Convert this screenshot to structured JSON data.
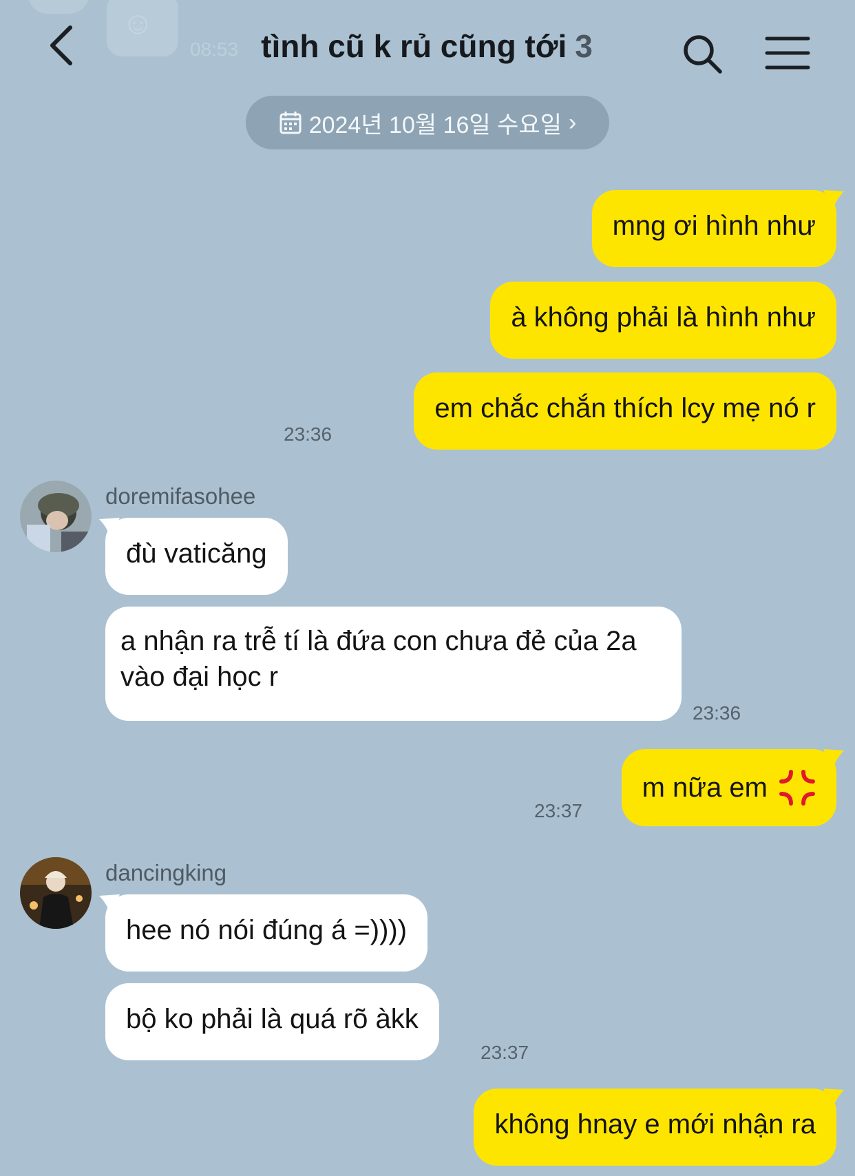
{
  "header": {
    "title": "tình cũ k rủ cũng tới",
    "member_count": "3",
    "ghost_time": "08:53"
  },
  "date_chip": {
    "label": "2024년 10월 16일 수요일",
    "arrow": "›"
  },
  "messages": [
    {
      "side": "me",
      "text": "mng ơi hình như"
    },
    {
      "side": "me",
      "text": "à không phải là hình như"
    },
    {
      "side": "me",
      "text": "em chắc chắn thích lcy mẹ nó r",
      "time": "23:36"
    },
    {
      "sender": "doremifasohee",
      "side": "them",
      "text": "đù vaticăng"
    },
    {
      "side": "them",
      "text": "a nhận ra trễ tí là đứa con chưa đẻ của 2a vào đại học r",
      "time": "23:36"
    },
    {
      "side": "me",
      "text": "m nữa em",
      "emoji": "💢",
      "time": "23:37"
    },
    {
      "sender": "dancingking",
      "side": "them",
      "text": "hee nó nói đúng á =))))"
    },
    {
      "side": "them",
      "text": "bộ ko phải là quá rõ àkk",
      "time": "23:37"
    },
    {
      "side": "me",
      "text": "không hnay e mới nhận ra"
    }
  ],
  "colors": {
    "background": "#abc1d1",
    "my_bubble": "#fee500",
    "their_bubble": "#ffffff",
    "date_chip": "#8ea4b4"
  },
  "icons": [
    "back-arrow-icon",
    "search-icon",
    "menu-icon",
    "calendar-icon",
    "anger-emoji-icon"
  ]
}
